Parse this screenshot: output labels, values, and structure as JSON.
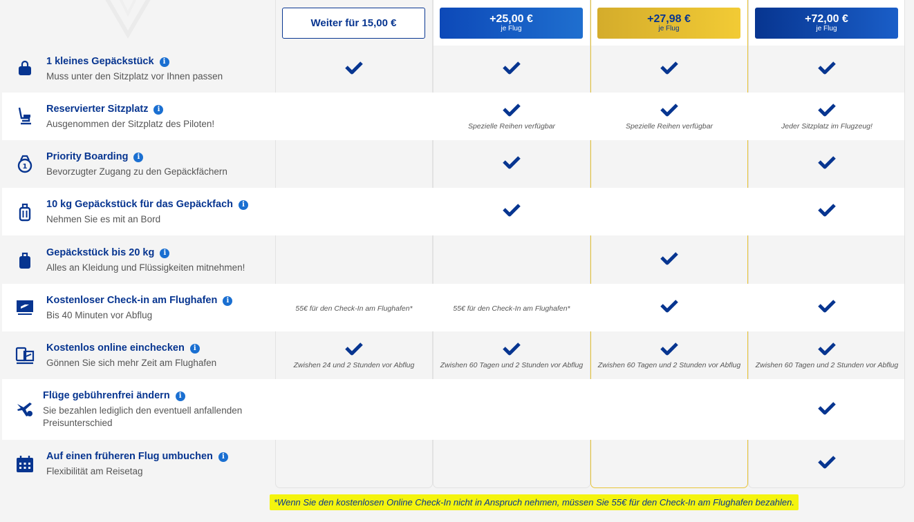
{
  "header": {
    "plans": [
      {
        "price": "Weiter für 15,00 €",
        "sub": ""
      },
      {
        "price": "+25,00 €",
        "sub": "je Flug"
      },
      {
        "price": "+27,98 €",
        "sub": "je Flug"
      },
      {
        "price": "+72,00 €",
        "sub": "je Flug"
      }
    ]
  },
  "features": [
    {
      "title": "1 kleines Gepäckstück",
      "subtitle": "Muss unter den Sitzplatz vor Ihnen passen",
      "icon": "small-bag-icon",
      "cells": [
        {
          "check": true,
          "note": ""
        },
        {
          "check": true,
          "note": ""
        },
        {
          "check": true,
          "note": ""
        },
        {
          "check": true,
          "note": ""
        }
      ]
    },
    {
      "title": "Reservierter Sitzplatz",
      "subtitle": "Ausgenommen der Sitzplatz des Piloten!",
      "icon": "seat-icon",
      "cells": [
        {
          "check": false,
          "note": ""
        },
        {
          "check": true,
          "note": "Spezielle Reihen verfügbar"
        },
        {
          "check": true,
          "note": "Spezielle Reihen verfügbar"
        },
        {
          "check": true,
          "note": "Jeder Sitzplatz im Flugzeug!"
        }
      ]
    },
    {
      "title": "Priority Boarding",
      "subtitle": "Bevorzugter Zugang zu den Gepäckfächern",
      "icon": "priority-icon",
      "cells": [
        {
          "check": false,
          "note": ""
        },
        {
          "check": true,
          "note": ""
        },
        {
          "check": false,
          "note": ""
        },
        {
          "check": true,
          "note": ""
        }
      ]
    },
    {
      "title": "10 kg Gepäckstück für das Gepäckfach",
      "subtitle": "Nehmen Sie es mit an Bord",
      "icon": "cabin-bag-icon",
      "cells": [
        {
          "check": false,
          "note": ""
        },
        {
          "check": true,
          "note": ""
        },
        {
          "check": false,
          "note": ""
        },
        {
          "check": true,
          "note": ""
        }
      ]
    },
    {
      "title": "Gepäckstück bis 20 kg",
      "subtitle": "Alles an Kleidung und Flüssigkeiten mitnehmen!",
      "icon": "suitcase-icon",
      "cells": [
        {
          "check": false,
          "note": ""
        },
        {
          "check": false,
          "note": ""
        },
        {
          "check": true,
          "note": ""
        },
        {
          "check": false,
          "note": ""
        }
      ]
    },
    {
      "title": "Kostenloser Check-in am Flughafen",
      "subtitle": "Bis 40 Minuten vor Abflug",
      "icon": "boarding-pass-icon",
      "cells": [
        {
          "check": false,
          "note": "55€ für den Check-In am Flughafen*"
        },
        {
          "check": false,
          "note": "55€ für den Check-In am Flughafen*"
        },
        {
          "check": true,
          "note": ""
        },
        {
          "check": true,
          "note": ""
        }
      ]
    },
    {
      "title": "Kostenlos online einchecken",
      "subtitle": "Gönnen Sie sich mehr Zeit am Flughafen",
      "icon": "online-checkin-icon",
      "cells": [
        {
          "check": true,
          "note": "Zwishen 24 und 2 Stunden vor Abflug"
        },
        {
          "check": true,
          "note": "Zwishen 60 Tagen und 2 Stunden vor Abflug"
        },
        {
          "check": true,
          "note": "Zwishen 60 Tagen und 2 Stunden vor Abflug"
        },
        {
          "check": true,
          "note": "Zwishen 60 Tagen und 2 Stunden vor Abflug"
        }
      ]
    },
    {
      "title": "Flüge gebührenfrei ändern",
      "subtitle": "Sie bezahlen lediglich den eventuell anfallenden Preisunterschied",
      "icon": "plane-change-icon",
      "cells": [
        {
          "check": false,
          "note": ""
        },
        {
          "check": false,
          "note": ""
        },
        {
          "check": false,
          "note": ""
        },
        {
          "check": true,
          "note": ""
        }
      ]
    },
    {
      "title": "Auf einen früheren Flug umbuchen",
      "subtitle": "Flexibilität am Reisetag",
      "icon": "calendar-icon",
      "cells": [
        {
          "check": false,
          "note": ""
        },
        {
          "check": false,
          "note": ""
        },
        {
          "check": false,
          "note": ""
        },
        {
          "check": true,
          "note": ""
        }
      ]
    }
  ],
  "info_glyph": "i",
  "footnote": "*Wenn Sie den kostenlosen Online Check-In nicht in Anspruch nehmen, müssen Sie 55€ für den Check-In am Flughafen bezahlen."
}
